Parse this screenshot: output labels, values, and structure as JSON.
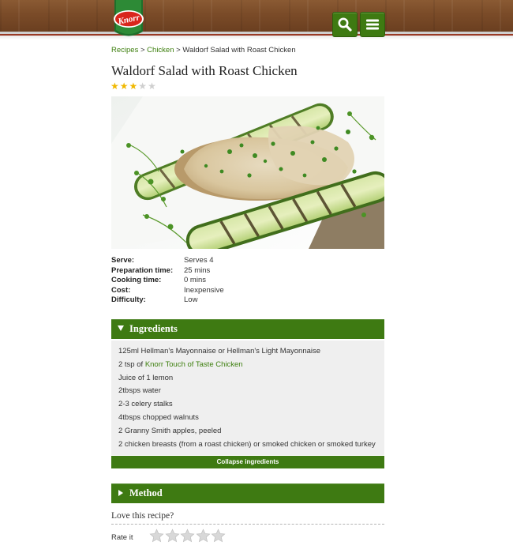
{
  "header": {
    "brand": "Knorr",
    "colors": {
      "accent_green": "#3e7a12",
      "wood": "#7a4b28",
      "brand_red": "#d9261c"
    },
    "icons": {
      "search": "search-icon",
      "menu": "menu-icon"
    }
  },
  "breadcrumb": {
    "items": [
      {
        "label": "Recipes"
      },
      {
        "label": "Chicken"
      },
      {
        "label": "Waldorf Salad with Roast Chicken"
      }
    ],
    "separator": ">"
  },
  "recipe": {
    "title": "Waldorf Salad with Roast Chicken",
    "rating": {
      "value": 3,
      "max": 5
    },
    "facts": [
      {
        "label": "Serve:",
        "value": "Serves 4"
      },
      {
        "label": "Preparation time:",
        "value": "25 mins"
      },
      {
        "label": "Cooking time:",
        "value": "0 mins"
      },
      {
        "label": "Cost:",
        "value": "Inexpensive"
      },
      {
        "label": "Difficulty:",
        "value": "Low"
      }
    ]
  },
  "ingredients": {
    "title": "Ingredients",
    "items": [
      {
        "text": "125ml Hellman's Mayonnaise or Hellman's Light Mayonnaise"
      },
      {
        "prefix": "2 tsp of ",
        "link": "Knorr Touch of Taste Chicken"
      },
      {
        "text": "Juice of 1 lemon"
      },
      {
        "text": "2tbsps water"
      },
      {
        "text": "2-3 celery stalks"
      },
      {
        "text": "4tbsps chopped walnuts"
      },
      {
        "text": "2 Granny Smith apples, peeled"
      },
      {
        "text": "2 chicken breasts (from a roast chicken) or smoked chicken or smoked turkey"
      }
    ],
    "collapse_label": "Collapse ingredients"
  },
  "method": {
    "title": "Method"
  },
  "feedback": {
    "love_label": "Love this recipe?",
    "rate_label": "Rate it",
    "rate_max": 5
  }
}
